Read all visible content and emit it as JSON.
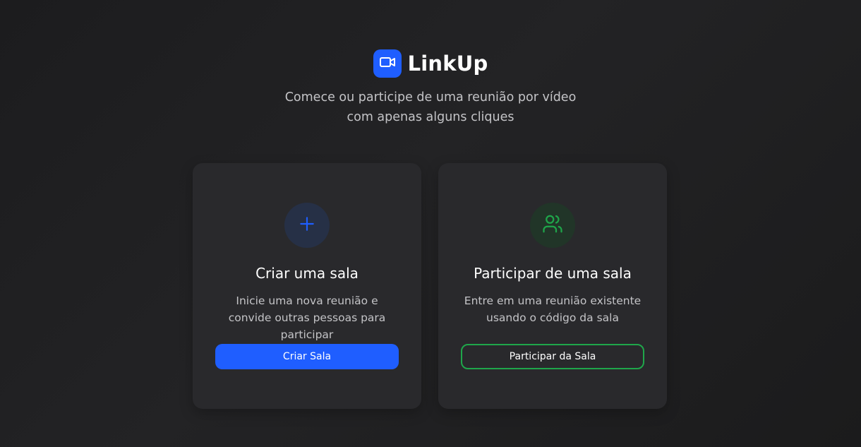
{
  "brand": {
    "name": "LinkUp",
    "logo_icon": "video-camera-icon",
    "accent": "#1f5eff"
  },
  "tagline": "Comece ou participe de uma reunião por vídeo com apenas alguns cliques",
  "cards": {
    "create": {
      "icon": "plus-icon",
      "title": "Criar uma sala",
      "description": "Inicie uma nova reunião e convide outras pessoas para participar",
      "button_label": "Criar Sala",
      "color": "#1f5eff"
    },
    "join": {
      "icon": "users-icon",
      "title": "Participar de uma sala",
      "description": "Entre em uma reunião existente usando o código da sala",
      "button_label": "Participar da Sala",
      "color": "#1fa64a"
    }
  }
}
